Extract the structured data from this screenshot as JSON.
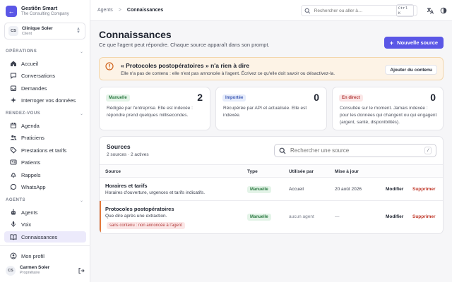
{
  "brand": {
    "name": "Gestiôn Smart",
    "subtitle": "The Consulting Company",
    "logo": "←"
  },
  "clinic": {
    "initials": "CS",
    "name": "Clinique Soler",
    "role": "Client"
  },
  "sidebar": {
    "sections": [
      {
        "label": "OPÉRATIONS",
        "items": [
          {
            "label": "Accueil",
            "icon": "home-icon"
          },
          {
            "label": "Conversations",
            "icon": "chat-icon"
          },
          {
            "label": "Demandes",
            "icon": "inbox-icon"
          },
          {
            "label": "Interroger vos données",
            "icon": "sparkle-icon"
          }
        ]
      },
      {
        "label": "RENDEZ-VOUS",
        "items": [
          {
            "label": "Agenda",
            "icon": "calendar-icon"
          },
          {
            "label": "Praticiens",
            "icon": "users-icon"
          },
          {
            "label": "Prestations et tarifs",
            "icon": "tag-icon"
          },
          {
            "label": "Patients",
            "icon": "id-card-icon"
          },
          {
            "label": "Rappels",
            "icon": "bell-icon"
          },
          {
            "label": "WhatsApp",
            "icon": "whatsapp-icon"
          }
        ]
      },
      {
        "label": "AGENTS",
        "items": [
          {
            "label": "Agents",
            "icon": "robot-icon"
          },
          {
            "label": "Voix",
            "icon": "mic-icon"
          },
          {
            "label": "Connaissances",
            "icon": "book-icon",
            "active": true
          }
        ]
      }
    ],
    "profile": "Mon profil"
  },
  "user": {
    "initials": "CS",
    "name": "Carmen Soler",
    "role": "Propriétaire"
  },
  "topbar": {
    "breadcrumb": [
      "Agents",
      "Connaissances"
    ],
    "separator": ">",
    "search_placeholder": "Rechercher ou aller à…",
    "search_shortcut": "Ctrl K"
  },
  "page": {
    "title": "Connaissances",
    "subtitle": "Ce que l'agent peut répondre. Chaque source apparaît dans son prompt.",
    "new_button": "Nouvelle source",
    "new_button_icon": "+"
  },
  "alert": {
    "title": "« Protocoles postopératoires » n'a rien à dire",
    "text": "Elle n'a pas de contenu : elle n'est pas annoncée à l'agent. Écrivez ce qu'elle doit savoir ou désactivez-la.",
    "button": "Ajouter du contenu"
  },
  "cards": [
    {
      "badge": "Manuelle",
      "color": "green",
      "count": "2",
      "desc": "Rédigée par l'entreprise. Elle est indexée : répondre prend quelques millisecondes."
    },
    {
      "badge": "Importée",
      "color": "blue",
      "count": "0",
      "desc": "Récupérée par API et actualisée. Elle est indexée."
    },
    {
      "badge": "En direct",
      "color": "red",
      "count": "0",
      "desc": "Consultée sur le moment. Jamais indexée : pour les données qui changent ou qui engagent (argent, santé, disponibilités)."
    }
  ],
  "sources": {
    "title": "Sources",
    "summary": "2 sources · 2 actives",
    "search_placeholder": "Rechercher une source",
    "search_shortcut": "/",
    "columns": [
      "Source",
      "Type",
      "Utilisée par",
      "Mise à jour"
    ],
    "rows": [
      {
        "name": "Horaires et tarifs",
        "desc": "Horaires d'ouverture, urgences et tarifs indicatifs.",
        "type": "Manuelle",
        "used_by": "Accueil",
        "updated": "20 août 2026",
        "modify": "Modifier",
        "delete": "Supprimer"
      },
      {
        "name": "Protocoles postopératoires",
        "desc": "Que dire après une extraction.",
        "warning": "sans contenu : non annoncée à l'agent",
        "type": "Manuelle",
        "used_by": "aucun agent",
        "updated": "—",
        "modify": "Modifier",
        "delete": "Supprimer"
      }
    ]
  }
}
